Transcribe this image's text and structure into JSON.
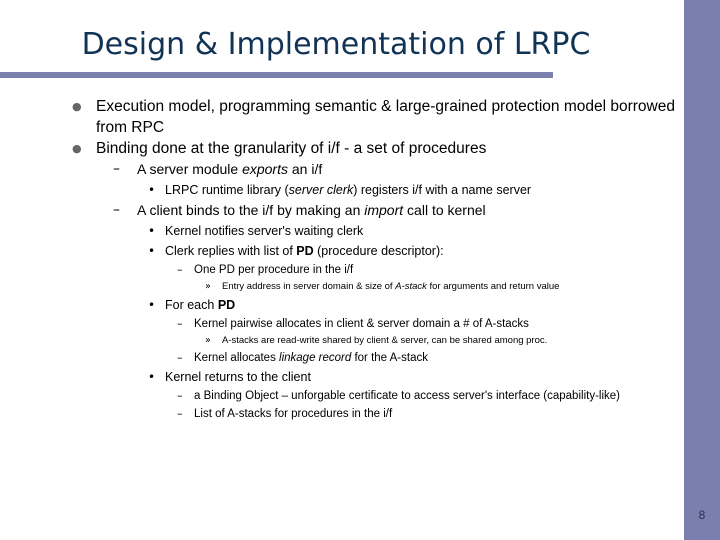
{
  "slide": {
    "title": "Design & Implementation of LRPC",
    "page_number": "8",
    "accent_color": "#7b7fad",
    "title_color": "#113355",
    "bullet_color": "#666666",
    "body_color": "#000000"
  },
  "bullets": {
    "glyph_dot_l1": "●",
    "glyph_dash": "–",
    "glyph_middot": "•",
    "glyph_guillemet": "»"
  },
  "body": [
    {
      "level": 1,
      "bullet": "●",
      "html": "Execution model, programming semantic &amp; large-grained protection model borrowed from RPC",
      "text": "Execution model, programming semantic & large-grained protection model borrowed from RPC"
    },
    {
      "level": 1,
      "bullet": "●",
      "html": "Binding done at the granularity of i/f - a set of procedures",
      "text": "Binding done at the granularity of i/f - a set of procedures"
    },
    {
      "level": 2,
      "bullet": "–",
      "html": "A server module <em>exports</em> an i/f",
      "text": "A server module exports an i/f"
    },
    {
      "level": 3,
      "bullet": "•",
      "html": "LRPC runtime library (<em>server clerk</em>) registers i/f with a name server",
      "text": "LRPC runtime library (server clerk) registers i/f with a name server"
    },
    {
      "level": 2,
      "bullet": "–",
      "html": "A client binds to the i/f by making an <em>import</em> call to kernel",
      "text": "A client binds to the i/f by making an import call to kernel"
    },
    {
      "level": 3,
      "bullet": "•",
      "html": "Kernel notifies server's waiting clerk",
      "text": "Kernel notifies server's waiting clerk"
    },
    {
      "level": 3,
      "bullet": "•",
      "html": "Clerk replies with list of <b>PD</b> (procedure descriptor):",
      "text": "Clerk replies with list of PD (procedure descriptor):"
    },
    {
      "level": 4,
      "bullet": "–",
      "html": "One PD per procedure in the i/f",
      "text": "One PD per procedure in the i/f"
    },
    {
      "level": 5,
      "bullet": "»",
      "html": "Entry address in server domain &amp; size of <em>A-stack</em> for arguments and return value",
      "text": "Entry address in server domain & size of A-stack for arguments and return value"
    },
    {
      "level": 3,
      "bullet": "•",
      "html": "For each <b>PD</b>",
      "text": "For each PD"
    },
    {
      "level": 4,
      "bullet": "–",
      "html": "Kernel pairwise allocates in client &amp; server domain a # of A-stacks",
      "text": "Kernel pairwise allocates in client & server domain a # of A-stacks"
    },
    {
      "level": 5,
      "bullet": "»",
      "html": "A-stacks are read-write shared by client &amp; server, can be shared among proc.",
      "text": "A-stacks are read-write shared by client & server, can be shared among proc."
    },
    {
      "level": 4,
      "bullet": "–",
      "html": "Kernel allocates <em>linkage record</em> for the A-stack",
      "text": "Kernel allocates linkage record for the A-stack"
    },
    {
      "level": 3,
      "bullet": "•",
      "html": "Kernel returns to the client",
      "text": "Kernel returns to the client"
    },
    {
      "level": 4,
      "bullet": "–",
      "html": "a Binding Object – unforgable certificate to access server's interface (capability-like)",
      "text": "a Binding Object – unforgable certificate to access server's interface (capability-like)"
    },
    {
      "level": 4,
      "bullet": "–",
      "html": "List of A-stacks for procedures in the i/f",
      "text": "List of A-stacks for procedures in the i/f"
    }
  ]
}
